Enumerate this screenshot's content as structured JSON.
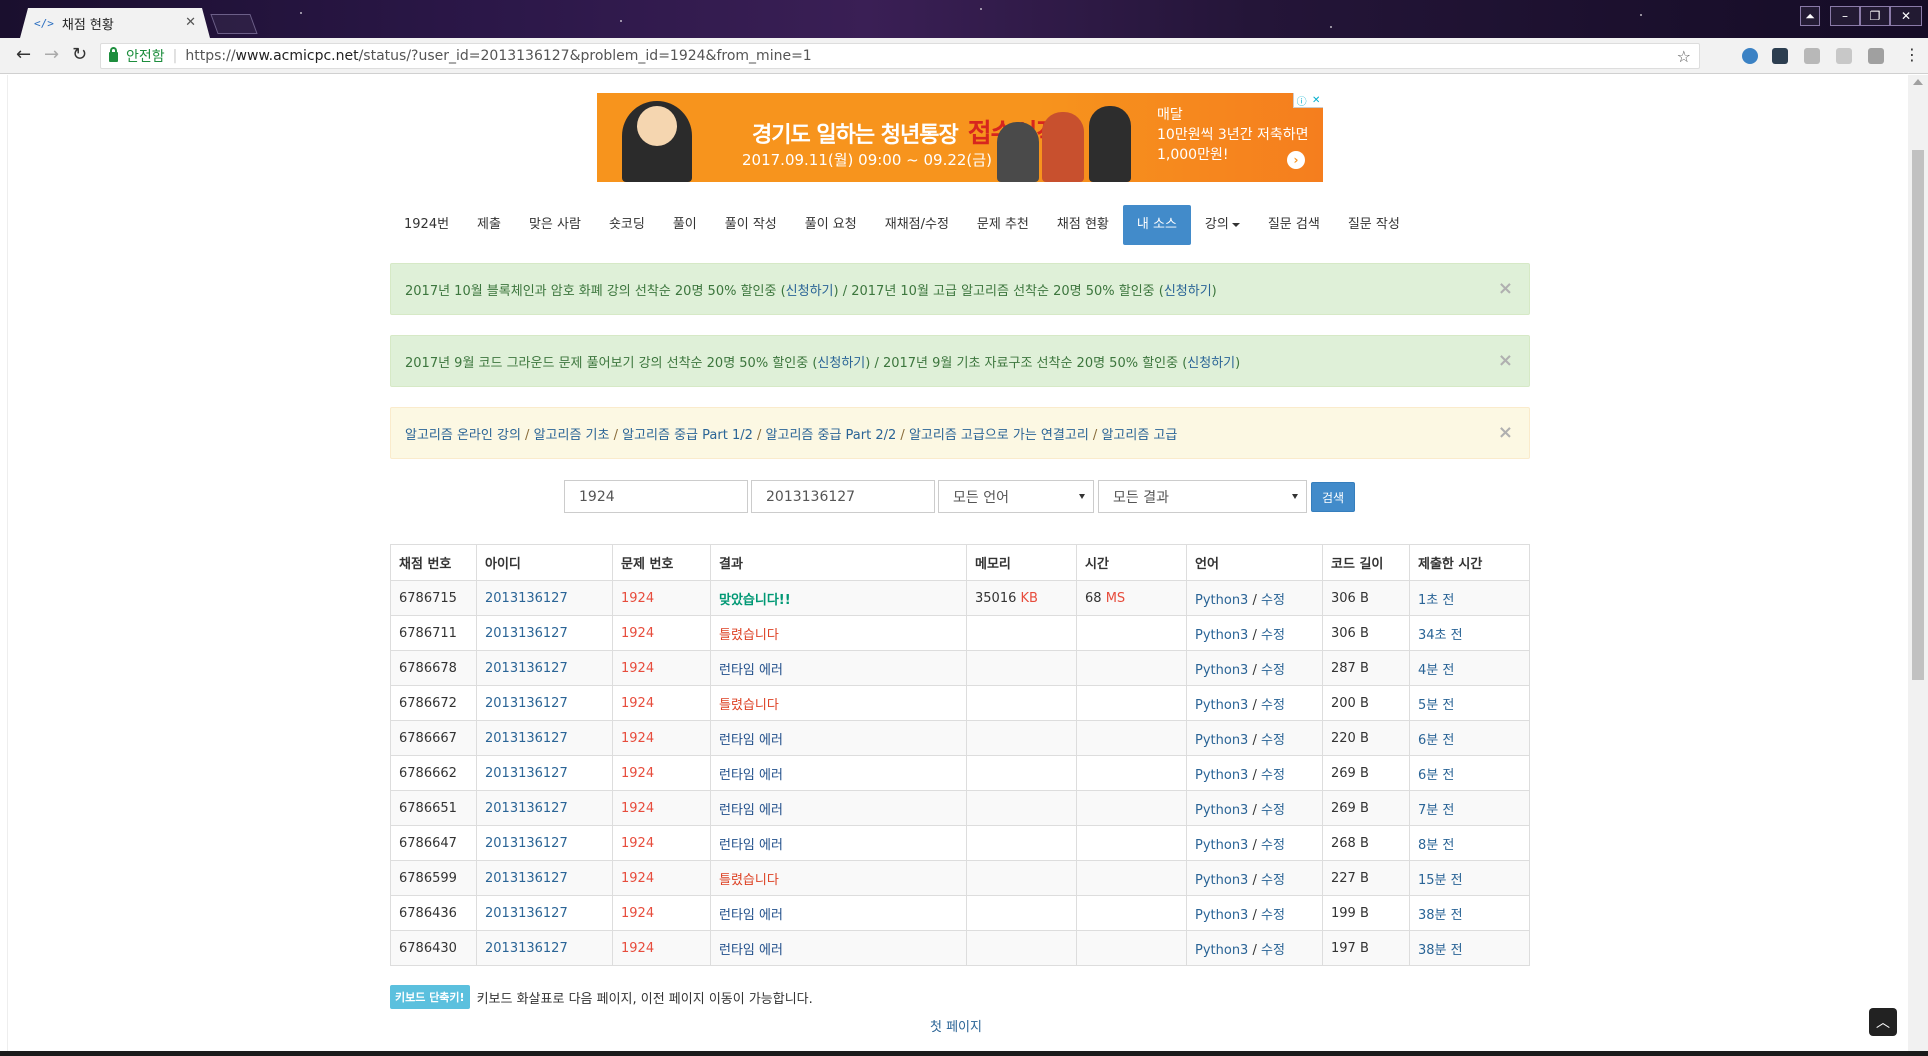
{
  "browser": {
    "tab_title": "채점 현황",
    "tab_favicon": "</>",
    "secure_label": "안전함",
    "url_prefix": "https://",
    "url_host": "www.acmicpc.net",
    "url_path": "/status/?user_id=2013136127&problem_id=1924&from_mine=1"
  },
  "ad": {
    "headline": "경기도 일하는 청년통장",
    "highlight": "접수시작",
    "date": "2017.09.11(월) 09:00 ~ 09.22(금) 18:00",
    "side_line1": "매달",
    "side_line2": "10만원씩 3년간 저축하면",
    "side_line3": "1,000만원!"
  },
  "nav": {
    "items": [
      "1924번",
      "제출",
      "맞은 사람",
      "숏코딩",
      "풀이",
      "풀이 작성",
      "풀이 요청",
      "재채점/수정",
      "문제 추천",
      "채점 현황",
      "내 소스",
      "강의",
      "질문 검색",
      "질문 작성"
    ]
  },
  "alerts": {
    "a1_part1": "2017년 10월 블록체인과 암호 화폐 강의 선착순 20명 50% 할인중 (",
    "a1_link1": "신청하기",
    "a1_part2": ") / 2017년 10월 고급 알고리즘 선착순 20명 50% 할인중 (",
    "a1_link2": "신청하기",
    "a1_part3": ")",
    "a2_part1": "2017년 9월 코드 그라운드 문제 풀어보기 강의 선착순 20명 50% 할인중 (",
    "a2_link1": "신청하기",
    "a2_part2": ") / 2017년 9월 기초 자료구조 선착순 20명 50% 할인중 (",
    "a2_link2": "신청하기",
    "a2_part3": ")",
    "a3_links": [
      "알고리즘 온라인 강의",
      "알고리즘 기초",
      "알고리즘 중급 Part 1/2",
      "알고리즘 중급 Part 2/2",
      "알고리즘 고급으로 가는 연결고리",
      "알고리즘 고급"
    ],
    "a3_sep": " / ",
    "close": "×"
  },
  "search": {
    "problem_id": "1924",
    "user_id": "2013136127",
    "language": "모든 언어",
    "result": "모든 결과",
    "button": "검색"
  },
  "table": {
    "headers": [
      "채점 번호",
      "아이디",
      "문제 번호",
      "결과",
      "메모리",
      "시간",
      "언어",
      "코드 길이",
      "제출한 시간"
    ],
    "rows": [
      {
        "id": "6786715",
        "user": "2013136127",
        "problem": "1924",
        "result": "맞았습니다!!",
        "memory": "35016",
        "memory_unit": "KB",
        "time": "68",
        "time_unit": "MS",
        "lang": "Python3",
        "edit": "수정",
        "length": "306 B",
        "submitted": "1초 전"
      },
      {
        "id": "6786711",
        "user": "2013136127",
        "problem": "1924",
        "result": "틀렸습니다",
        "memory": "",
        "memory_unit": "",
        "time": "",
        "time_unit": "",
        "lang": "Python3",
        "edit": "수정",
        "length": "306 B",
        "submitted": "34초 전"
      },
      {
        "id": "6786678",
        "user": "2013136127",
        "problem": "1924",
        "result": "런타임 에러",
        "memory": "",
        "memory_unit": "",
        "time": "",
        "time_unit": "",
        "lang": "Python3",
        "edit": "수정",
        "length": "287 B",
        "submitted": "4분 전"
      },
      {
        "id": "6786672",
        "user": "2013136127",
        "problem": "1924",
        "result": "틀렸습니다",
        "memory": "",
        "memory_unit": "",
        "time": "",
        "time_unit": "",
        "lang": "Python3",
        "edit": "수정",
        "length": "200 B",
        "submitted": "5분 전"
      },
      {
        "id": "6786667",
        "user": "2013136127",
        "problem": "1924",
        "result": "런타임 에러",
        "memory": "",
        "memory_unit": "",
        "time": "",
        "time_unit": "",
        "lang": "Python3",
        "edit": "수정",
        "length": "220 B",
        "submitted": "6분 전"
      },
      {
        "id": "6786662",
        "user": "2013136127",
        "problem": "1924",
        "result": "런타임 에러",
        "memory": "",
        "memory_unit": "",
        "time": "",
        "time_unit": "",
        "lang": "Python3",
        "edit": "수정",
        "length": "269 B",
        "submitted": "6분 전"
      },
      {
        "id": "6786651",
        "user": "2013136127",
        "problem": "1924",
        "result": "런타임 에러",
        "memory": "",
        "memory_unit": "",
        "time": "",
        "time_unit": "",
        "lang": "Python3",
        "edit": "수정",
        "length": "269 B",
        "submitted": "7분 전"
      },
      {
        "id": "6786647",
        "user": "2013136127",
        "problem": "1924",
        "result": "런타임 에러",
        "memory": "",
        "memory_unit": "",
        "time": "",
        "time_unit": "",
        "lang": "Python3",
        "edit": "수정",
        "length": "268 B",
        "submitted": "8분 전"
      },
      {
        "id": "6786599",
        "user": "2013136127",
        "problem": "1924",
        "result": "틀렸습니다",
        "memory": "",
        "memory_unit": "",
        "time": "",
        "time_unit": "",
        "lang": "Python3",
        "edit": "수정",
        "length": "227 B",
        "submitted": "15분 전"
      },
      {
        "id": "6786436",
        "user": "2013136127",
        "problem": "1924",
        "result": "런타임 에러",
        "memory": "",
        "memory_unit": "",
        "time": "",
        "time_unit": "",
        "lang": "Python3",
        "edit": "수정",
        "length": "199 B",
        "submitted": "38분 전"
      },
      {
        "id": "6786430",
        "user": "2013136127",
        "problem": "1924",
        "result": "런타임 에러",
        "memory": "",
        "memory_unit": "",
        "time": "",
        "time_unit": "",
        "lang": "Python3",
        "edit": "수정",
        "length": "197 B",
        "submitted": "38분 전"
      }
    ]
  },
  "footer": {
    "kbd_badge": "키보드 단축키!",
    "kbd_text": "키보드 화살표로 다음 페이지, 이전 페이지 이동이 가능합니다.",
    "first_page": "첫 페이지"
  }
}
